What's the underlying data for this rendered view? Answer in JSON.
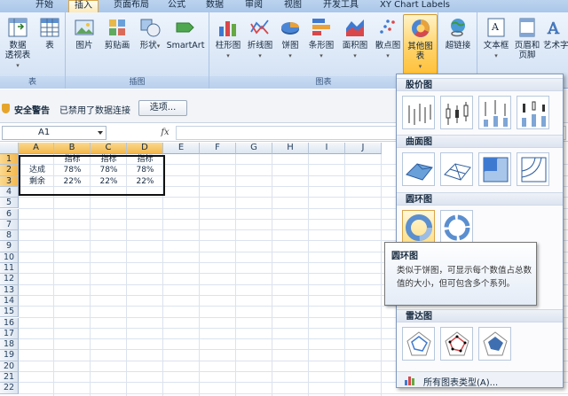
{
  "tabs": [
    "开始",
    "插入",
    "页面布局",
    "公式",
    "数据",
    "审阅",
    "视图",
    "开发工具",
    "XY Chart Labels"
  ],
  "active_tab": "插入",
  "ribbon": {
    "tables_group": {
      "label": "表",
      "pivot_line1": "数据",
      "pivot_line2": "透视表",
      "table": "表"
    },
    "illustrations_group": {
      "label": "插图",
      "picture": "图片",
      "clipart": "剪贴画",
      "shapes": "形状",
      "smartart": "SmartArt"
    },
    "charts_group": {
      "label": "图表",
      "column": "柱形图",
      "line": "折线图",
      "pie": "饼图",
      "bar": "条形图",
      "area": "面积图",
      "scatter": "散点图",
      "other": "其他图表"
    },
    "links_group": {
      "hyperlink": "超链接"
    },
    "text_group": {
      "textbox": "文本框",
      "header_line1": "页眉和",
      "header_line2": "页脚",
      "wordart": "艺术字"
    }
  },
  "security_bar": {
    "title": "安全警告",
    "message": "已禁用了数据连接",
    "options_button": "选项..."
  },
  "formula_bar": {
    "name_box": "A1",
    "fx": "fx",
    "value": ""
  },
  "columns": [
    "A",
    "B",
    "C",
    "D",
    "E",
    "F",
    "G",
    "H",
    "I",
    "J"
  ],
  "rows": [
    "1",
    "2",
    "3",
    "4",
    "5",
    "6",
    "7",
    "8",
    "9",
    "10",
    "11",
    "12",
    "13",
    "14",
    "15",
    "16",
    "17",
    "18",
    "19",
    "20",
    "21",
    "22"
  ],
  "cells": {
    "B1": "指标",
    "C1": "指标",
    "D1": "指标",
    "A2": "达成",
    "B2": "78%",
    "C2": "78%",
    "D2": "78%",
    "A3": "剩余",
    "B3": "22%",
    "C3": "22%",
    "D3": "22%"
  },
  "gallery": {
    "stock": "股价图",
    "surface": "曲面图",
    "doughnut": "圆环图",
    "radar": "雷达图",
    "all_types": "所有图表类型(A)..."
  },
  "tooltip": {
    "title": "圆环图",
    "body": "类似于饼图，可显示每个数值占总数值的大小，但可包含多个系列。"
  },
  "colors": {
    "accent": "#ffc13a",
    "ribbon": "#dce8f7",
    "border": "#8db2e3"
  }
}
